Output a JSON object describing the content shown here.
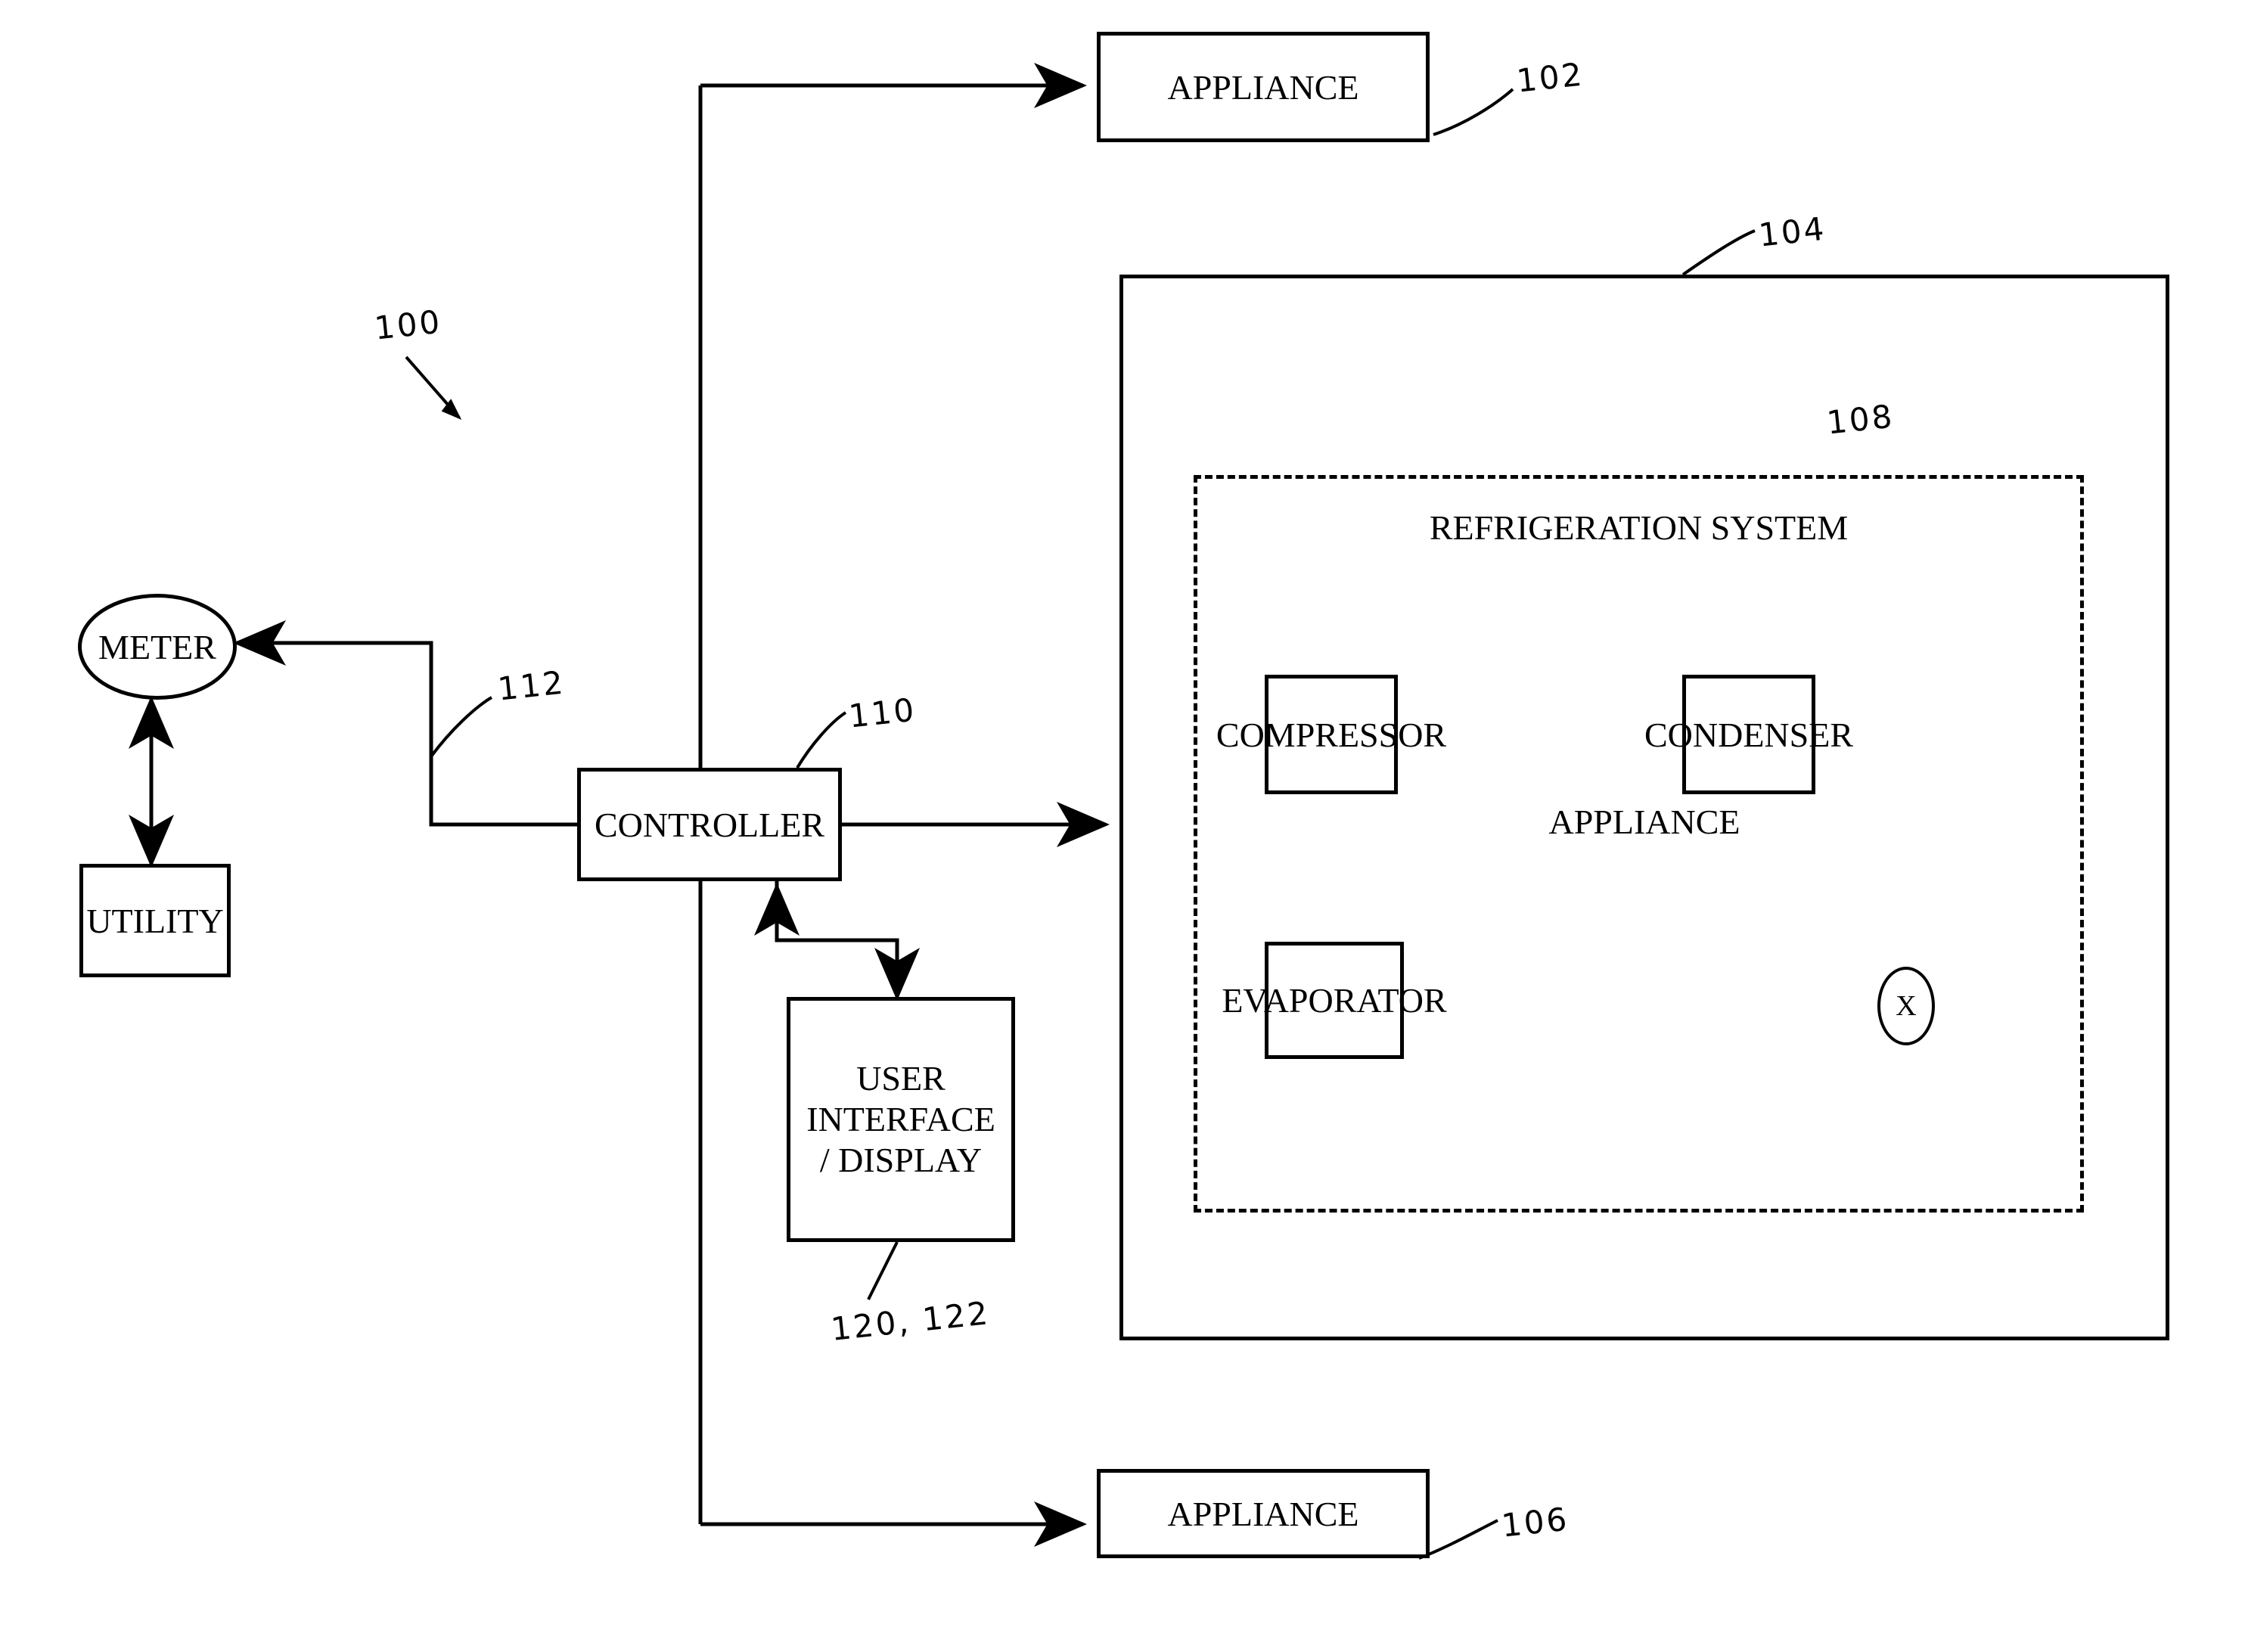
{
  "figure": {
    "type": "patent-block-diagram",
    "system_ref": "100"
  },
  "nodes": {
    "appliance_top": {
      "label": "APPLIANCE",
      "ref": "102"
    },
    "appliance_main": {
      "label": "APPLIANCE",
      "ref": "104"
    },
    "appliance_bottom": {
      "label": "APPLIANCE",
      "ref": "106"
    },
    "refrigeration_system": {
      "label": "REFRIGERATION SYSTEM",
      "ref": "108"
    },
    "compressor": {
      "label": "COMPRESSOR"
    },
    "condenser": {
      "label": "CONDENSER"
    },
    "evaporator": {
      "label": "EVAPORATOR"
    },
    "expansion_valve": {
      "label": "X"
    },
    "meter": {
      "label": "METER"
    },
    "utility": {
      "label": "UTILITY"
    },
    "controller": {
      "label": "CONTROLLER",
      "ref": "110"
    },
    "user_interface": {
      "label": "USER\nINTERFACE\n/ DISPLAY",
      "line1": "USER",
      "line2": "INTERFACE",
      "line3": "/ DISPLAY",
      "ref": "120, 122"
    },
    "link_meter_controller": {
      "ref": "112"
    }
  },
  "connections": [
    {
      "from": "controller",
      "to": "appliance_top",
      "arrow": "single"
    },
    {
      "from": "controller",
      "to": "appliance_main",
      "arrow": "single"
    },
    {
      "from": "controller",
      "to": "appliance_bottom",
      "arrow": "single"
    },
    {
      "from": "controller",
      "to": "meter",
      "arrow": "single",
      "ref": "112"
    },
    {
      "from": "meter",
      "to": "utility",
      "arrow": "double"
    },
    {
      "from": "controller",
      "to": "user_interface",
      "arrow": "double"
    },
    {
      "from": "compressor",
      "to": "condenser",
      "arrow": "single"
    },
    {
      "from": "condenser",
      "to": "expansion_valve",
      "arrow": "single"
    },
    {
      "from": "expansion_valve",
      "to": "evaporator",
      "arrow": "single"
    },
    {
      "from": "evaporator",
      "to": "compressor",
      "arrow": "single"
    }
  ],
  "colors": {
    "stroke": "#000000",
    "background": "#ffffff"
  }
}
